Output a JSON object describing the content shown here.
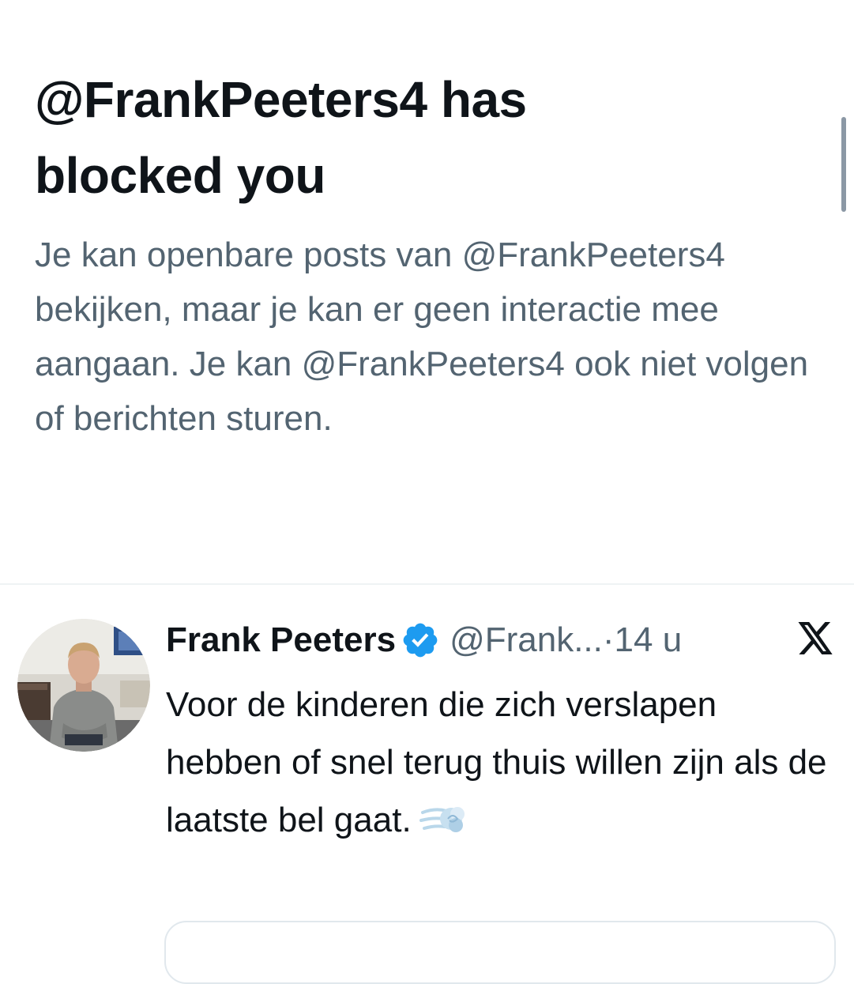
{
  "blocked": {
    "title": "@FrankPeeters4 has blocked you",
    "description": "Je kan openbare posts van @FrankPeeters4 bekijken, maar je kan er geen interactie mee aangaan. Je kan @FrankPeeters4 ook niet volgen of berichten sturen."
  },
  "post": {
    "author_name": "Frank Peeters",
    "handle": "@Frank...",
    "separator": "·",
    "time": "14 u",
    "text": "Voor de kinderen die zich verslapen hebben of snel terug thuis willen zijn als de laatste bel gaat.",
    "emoji": "dashing-away-emoji",
    "verified": true,
    "source_icon": "x-logo-icon"
  },
  "colors": {
    "primary_text": "#0f1419",
    "secondary_text": "#536471",
    "verified_blue": "#1d9bf0",
    "divider": "#eff3f4"
  }
}
